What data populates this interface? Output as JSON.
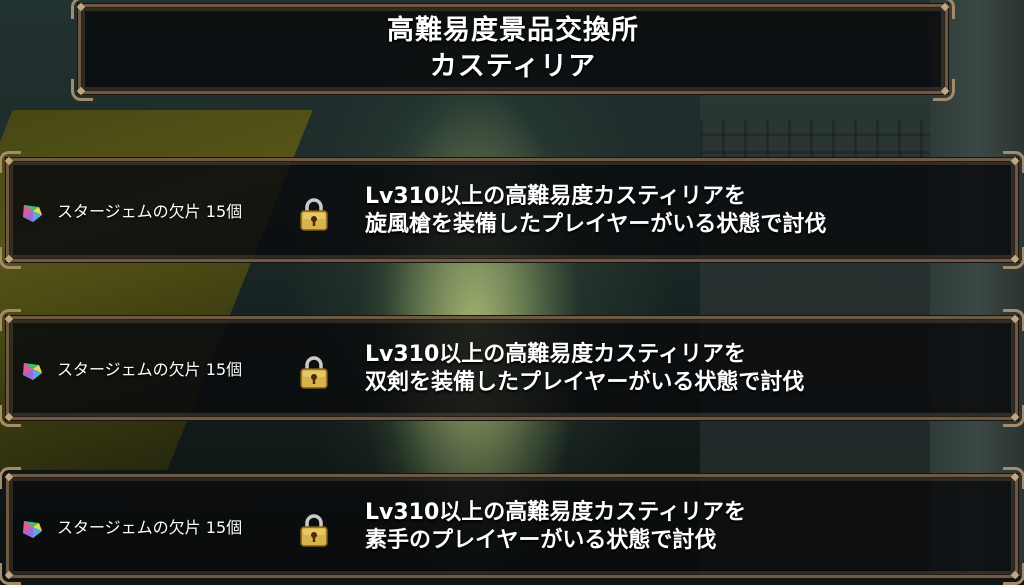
{
  "header": {
    "title_line1": "高難易度景品交換所",
    "title_line2": "カスティリア"
  },
  "rewards": [
    {
      "item_label": "スタージェムの欠片 15個",
      "item_icon": "star-gem-fragment-icon",
      "locked": true,
      "condition_line1": "Lv310以上の高難易度カスティリアを",
      "condition_line2": "旋風槍を装備したプレイヤーがいる状態で討伐"
    },
    {
      "item_label": "スタージェムの欠片 15個",
      "item_icon": "star-gem-fragment-icon",
      "locked": true,
      "condition_line1": "Lv310以上の高難易度カスティリアを",
      "condition_line2": "双剣を装備したプレイヤーがいる状態で討伐"
    },
    {
      "item_label": "スタージェムの欠片 15個",
      "item_icon": "star-gem-fragment-icon",
      "locked": true,
      "condition_line1": "Lv310以上の高難易度カスティリアを",
      "condition_line2": "素手のプレイヤーがいる状態で討伐"
    }
  ],
  "colors": {
    "frame_border": "#6e5a44",
    "frame_ornament": "#a58a6a",
    "panel_bg": "#0a0c0e",
    "lock_gold": "#d8b24a",
    "text": "#ffffff"
  }
}
